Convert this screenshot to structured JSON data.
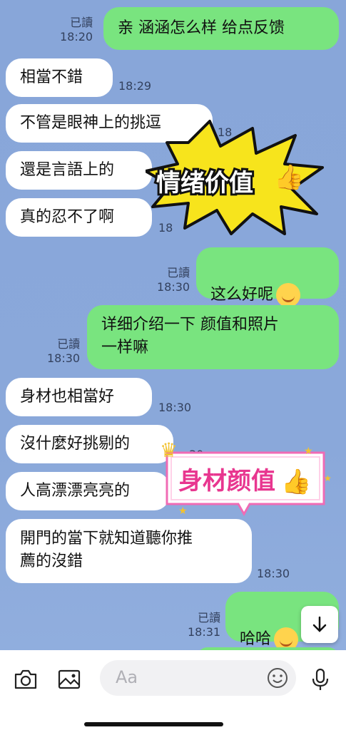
{
  "messages": [
    {
      "side": "me",
      "text": "亲 涵涵怎么样 给点反馈",
      "read": "已讀",
      "time": "18:20"
    },
    {
      "side": "them",
      "text": "相當不錯",
      "time": "18:29"
    },
    {
      "side": "them",
      "text": "不管是眼神上的挑逗",
      "time": "18"
    },
    {
      "side": "them",
      "text": "還是言語上的",
      "time": ""
    },
    {
      "side": "them",
      "text": "真的忍不了啊",
      "time": "18"
    },
    {
      "side": "me",
      "text": "这么好呢",
      "read": "已讀",
      "time": "18:30"
    },
    {
      "side": "me",
      "text": "详细介绍一下 颜值和照片\n一样嘛",
      "read": "已讀",
      "time": "18:30"
    },
    {
      "side": "them",
      "text": "身材也相當好",
      "time": "18:30"
    },
    {
      "side": "them",
      "text": "沒什麼好挑剔的",
      "time": "30"
    },
    {
      "side": "them",
      "text": "人高漂漂亮亮的",
      "time": ""
    },
    {
      "side": "them",
      "text": "開門的當下就知道聽你推\n薦的沒錯",
      "time": "18:30"
    },
    {
      "side": "me",
      "text": "哈哈",
      "read": "已讀",
      "time": "18:31"
    }
  ],
  "stickers": {
    "burst_text": "情绪价值",
    "tag_text": "身材颜值"
  },
  "composer": {
    "placeholder": "Aa"
  },
  "colors": {
    "my_bubble": "#79e47f",
    "their_bubble": "#ffffff",
    "background": "#88a6d9",
    "sticker_yellow": "#f7e41c",
    "sticker_pink": "#e8368f"
  },
  "icons": {
    "camera": "camera-icon",
    "gallery": "image-icon",
    "emoji": "smiley-icon",
    "mic": "microphone-icon",
    "scroll": "arrow-down-icon"
  }
}
